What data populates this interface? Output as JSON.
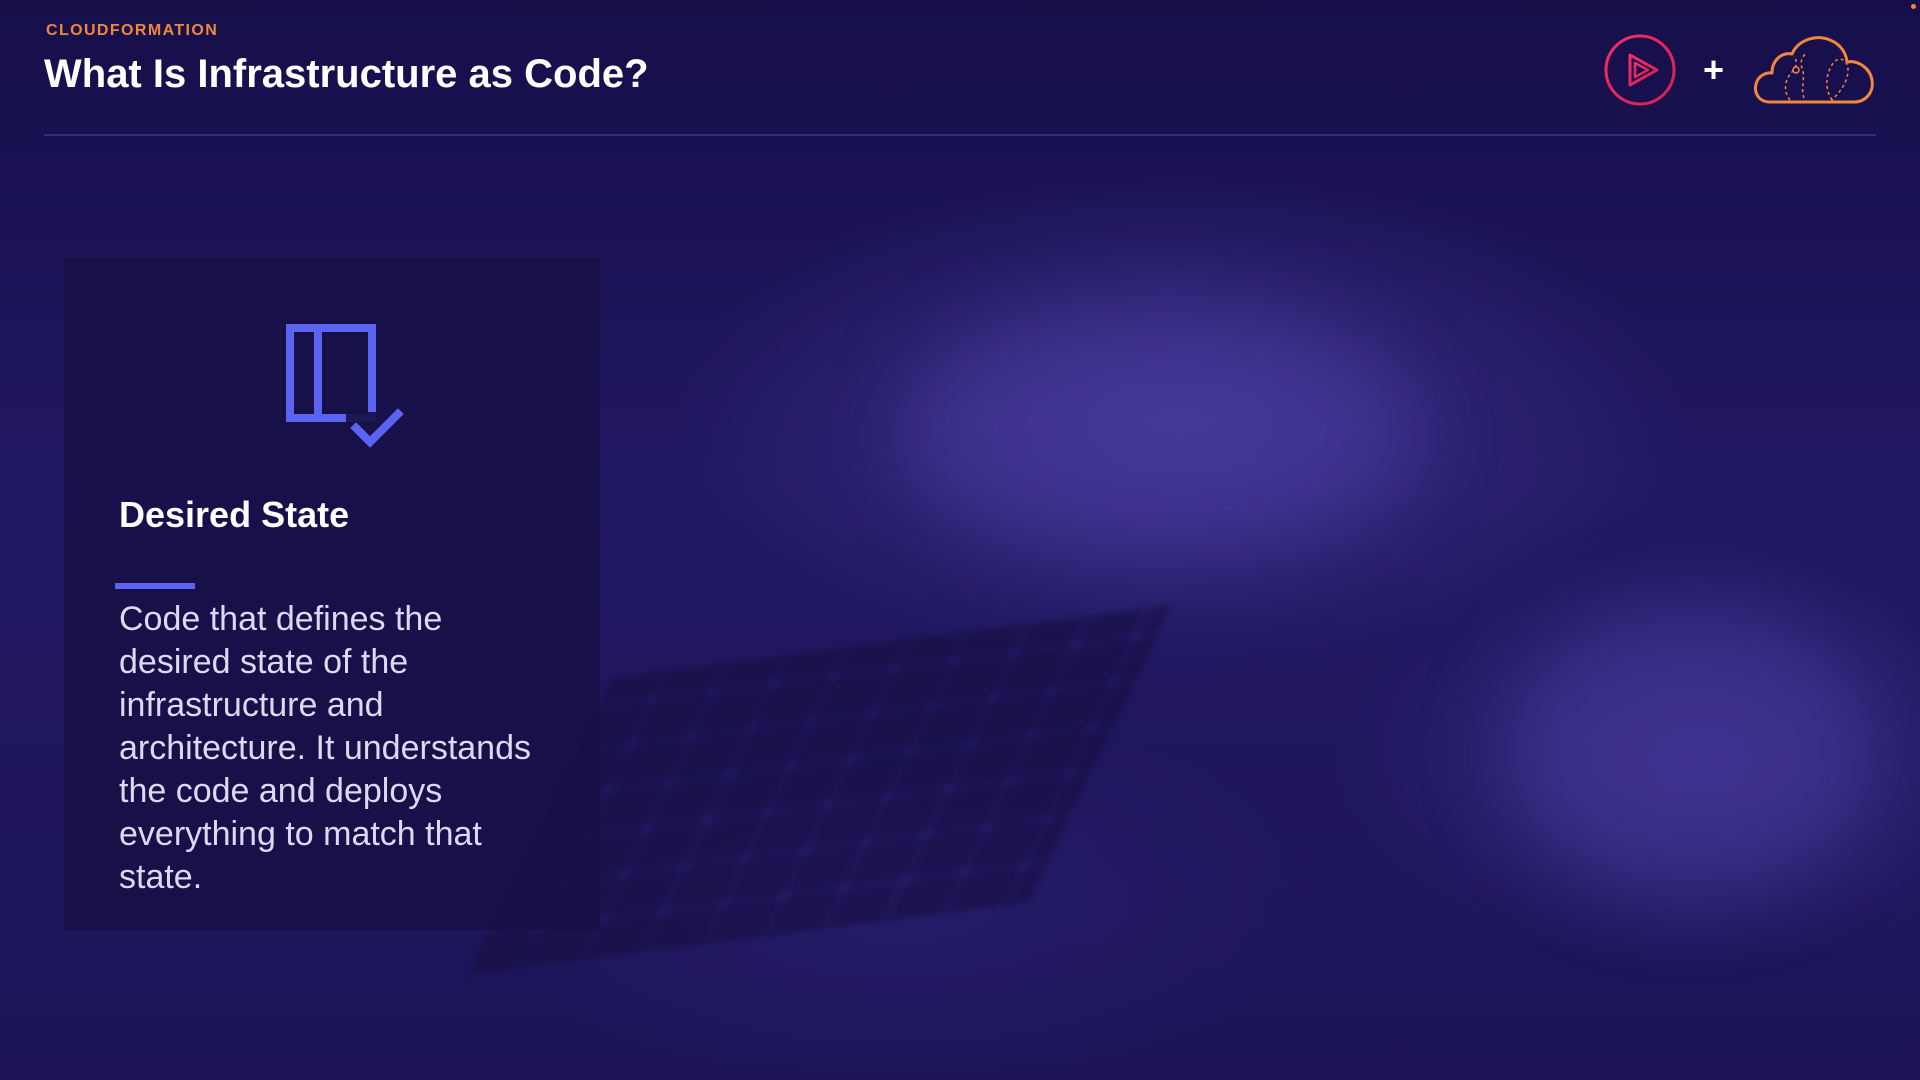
{
  "header": {
    "eyebrow": "CLOUDFORMATION",
    "title": "What Is Infrastructure as Code?",
    "plus": "+"
  },
  "card": {
    "icon": "desired-state-icon",
    "title": "Desired State",
    "body": "Code that defines the desired state of the infrastructure and architecture. It understands the code and deploys everything to match that state."
  },
  "logos": {
    "left": "play-logo-icon",
    "right": "cloud-logo-icon"
  },
  "colors": {
    "accent_orange": "#f2873c",
    "accent_blue": "#5b63f2",
    "logo_red": "#e5245d",
    "background": "#1d1558"
  }
}
